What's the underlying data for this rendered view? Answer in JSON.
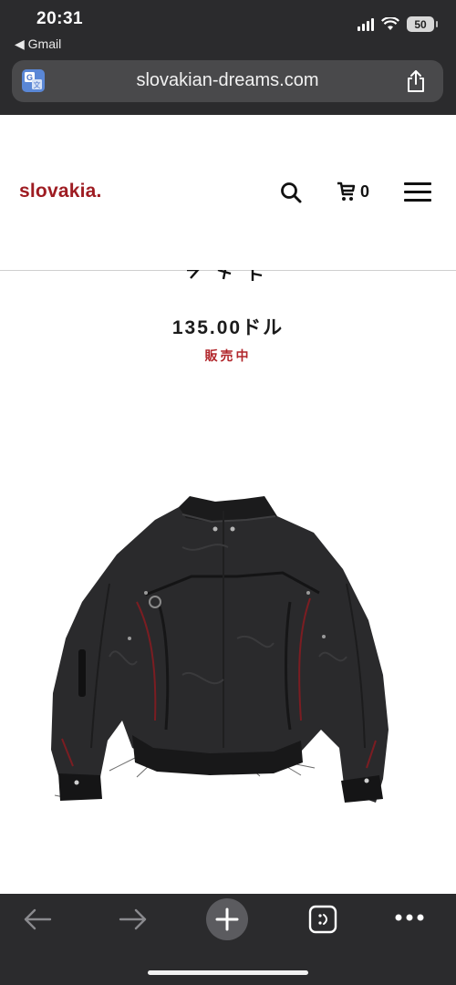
{
  "status_bar": {
    "time": "20:31",
    "back_app": "◀ Gmail",
    "battery": "50"
  },
  "browser": {
    "url": "slovakian-dreams.com",
    "translate_icon": "google-translate-icon",
    "share_icon": "share-icon"
  },
  "site": {
    "logo": "slovakia",
    "logo_dot": ".",
    "cart_count": "0"
  },
  "product": {
    "price": "135.00ドル",
    "status": "販売中",
    "image": "black-bomber-jacket-back-view"
  },
  "toolbar": {
    "back_icon": "arrow-left-icon",
    "forward_icon": "arrow-right-icon",
    "new_tab_icon": "plus-icon",
    "tabs_icon": "tabs-icon",
    "more_icon": "more-icon"
  },
  "colors": {
    "brand": "#9e1c22",
    "stock": "#b1262b",
    "chrome": "#2b2b2d"
  }
}
